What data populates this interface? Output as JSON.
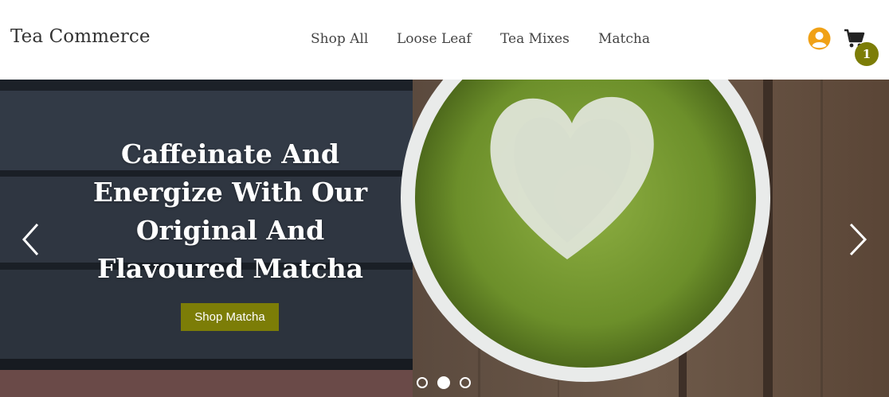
{
  "header": {
    "brand": "Tea Commerce",
    "nav": [
      {
        "label": "Shop All"
      },
      {
        "label": "Loose Leaf"
      },
      {
        "label": "Tea Mixes"
      },
      {
        "label": "Matcha"
      }
    ],
    "account_icon": "user-circle-icon",
    "cart_icon": "shopping-cart-icon",
    "cart_count": "1"
  },
  "hero": {
    "headline": "Caffeinate And Energize With Our Original And Flavoured Matcha",
    "cta_label": "Shop Matcha",
    "prev_icon": "chevron-left-icon",
    "next_icon": "chevron-right-icon",
    "slide_count": 3,
    "active_slide": 2
  },
  "colors": {
    "accent": "#7c7d07",
    "account_icon": "#f0a116",
    "text": "#333333"
  }
}
